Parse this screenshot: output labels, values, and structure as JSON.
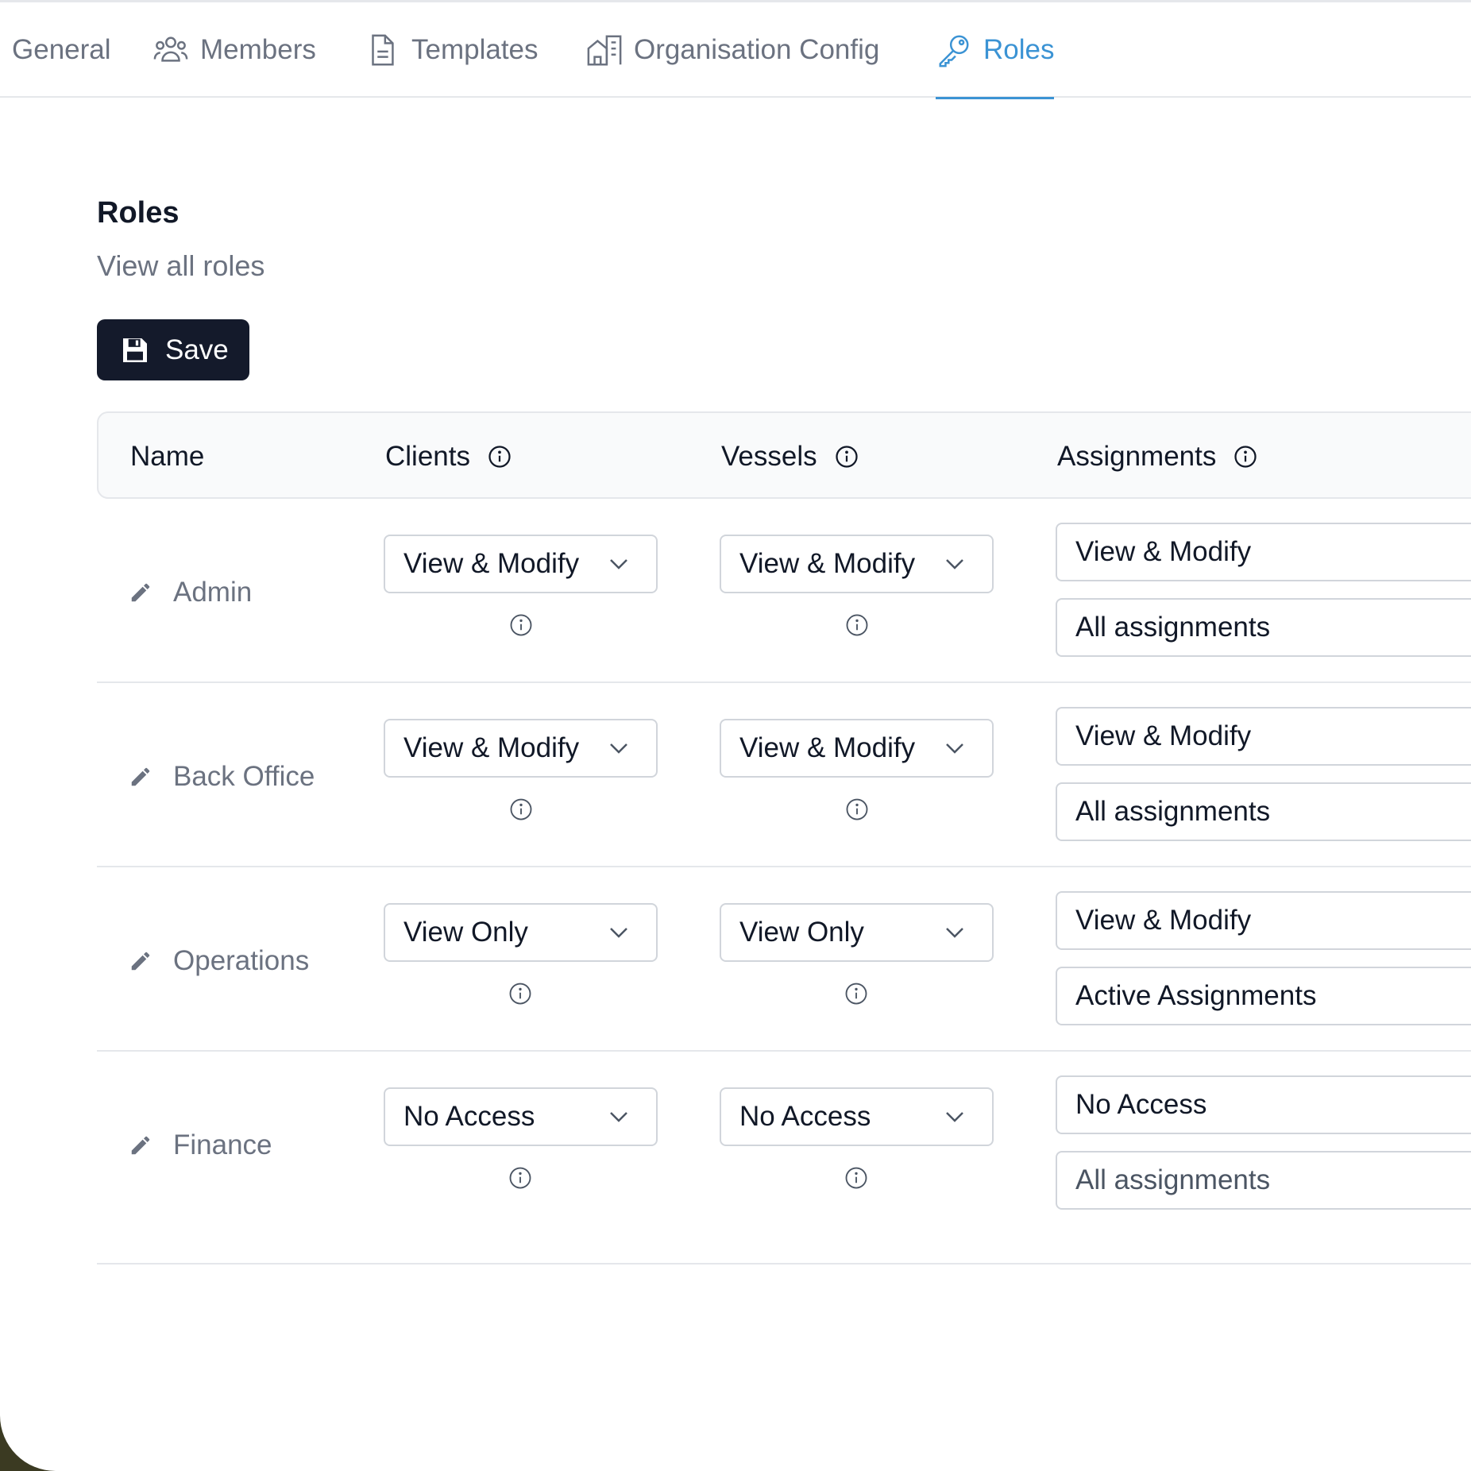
{
  "tabs": [
    {
      "label": "General",
      "icon": "none",
      "active": false
    },
    {
      "label": "Members",
      "icon": "users-icon",
      "active": false
    },
    {
      "label": "Templates",
      "icon": "document-icon",
      "active": false
    },
    {
      "label": "Organisation Config",
      "icon": "building-icon",
      "active": false
    },
    {
      "label": "Roles",
      "icon": "key-icon",
      "active": true
    }
  ],
  "colors": {
    "accent": "#3b93d4",
    "button_bg": "#141a2b",
    "muted_text": "#6b7280",
    "border": "#e5e7eb"
  },
  "section": {
    "title": "Roles",
    "subtitle": "View all roles"
  },
  "save_button": {
    "label": "Save",
    "icon": "floppy-disk-icon"
  },
  "table": {
    "columns": [
      "Name",
      "Clients",
      "Vessels",
      "Assignments"
    ],
    "rows": [
      {
        "name": "Admin",
        "clients": "View & Modify",
        "vessels": "View & Modify",
        "assignments_access": "View & Modify",
        "assignments_scope": "All assignments"
      },
      {
        "name": "Back Office",
        "clients": "View & Modify",
        "vessels": "View & Modify",
        "assignments_access": "View & Modify",
        "assignments_scope": "All assignments"
      },
      {
        "name": "Operations",
        "clients": "View Only",
        "vessels": "View Only",
        "assignments_access": "View & Modify",
        "assignments_scope": "Active Assignments"
      },
      {
        "name": "Finance",
        "clients": "No Access",
        "vessels": "No Access",
        "assignments_access": "No Access",
        "assignments_scope": "All assignments"
      }
    ]
  }
}
